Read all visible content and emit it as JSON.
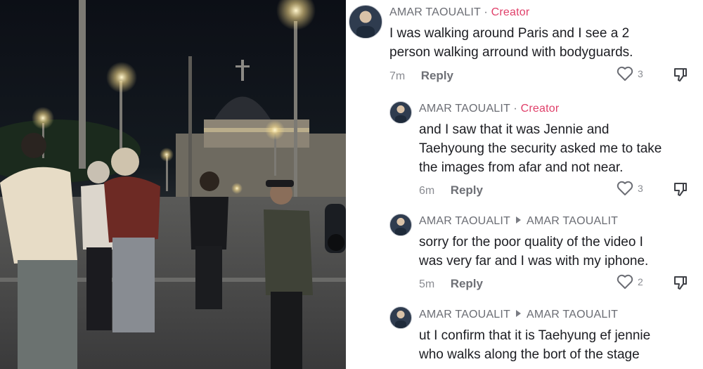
{
  "photo": {
    "description_icon": "night-street-photo"
  },
  "comments": [
    {
      "author": "AMAR TAOUALIT",
      "separator": "·",
      "badge": "Creator",
      "reply_to": null,
      "lines": [
        "I was walking around Paris and I see a 2",
        "person walking arround with bodyguards."
      ],
      "time": "7m",
      "reply_label": "Reply",
      "likes": "3"
    },
    {
      "author": "AMAR TAOUALIT",
      "separator": "·",
      "badge": "Creator",
      "reply_to": null,
      "lines": [
        "and I saw that it was Jennie and",
        "Taehyoung the security asked me to take",
        "the images from afar and not near."
      ],
      "time": "6m",
      "reply_label": "Reply",
      "likes": "3"
    },
    {
      "author": "AMAR TAOUALIT",
      "separator": null,
      "badge": null,
      "reply_to": "AMAR TAOUALIT",
      "lines": [
        "sorry for the poor quality of the video I",
        "was very far and I was with my iphone."
      ],
      "time": "5m",
      "reply_label": "Reply",
      "likes": "2"
    },
    {
      "author": "AMAR TAOUALIT",
      "separator": null,
      "badge": null,
      "reply_to": "AMAR TAOUALIT",
      "lines": [
        "ut I confirm that it is Taehyung ef jennie",
        "who walks along the bort of the stage"
      ],
      "time": null,
      "reply_label": null,
      "likes": null
    }
  ],
  "icons": {
    "like": "heart-outline-icon",
    "dislike": "thumbs-down-icon",
    "reply_arrow": "caret-right-icon"
  },
  "colors": {
    "creator_badge": "#e0406a",
    "text": "#1c1d22",
    "meta": "#8a8c92"
  }
}
